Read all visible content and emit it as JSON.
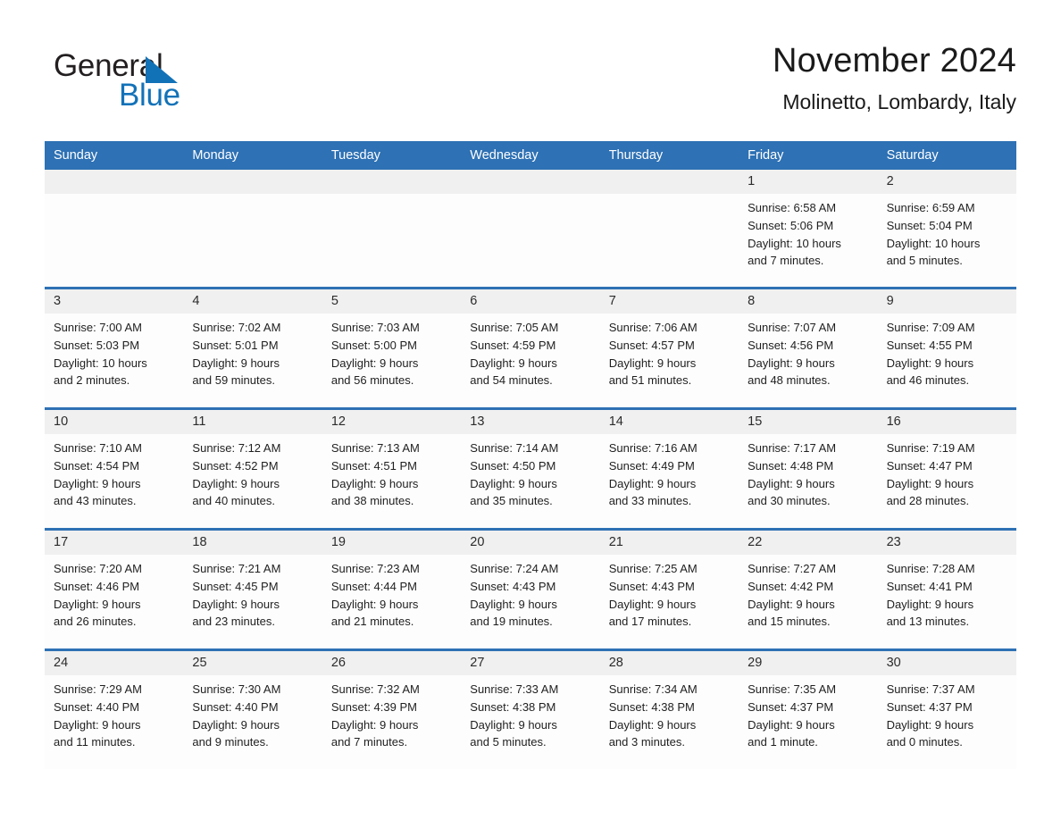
{
  "brand": {
    "name_part1": "General",
    "name_part2": "Blue",
    "triangle_icon": "triangle-icon",
    "color_black": "#231f20",
    "color_blue": "#1272b8"
  },
  "header": {
    "title": "November 2024",
    "subtitle": "Molinetto, Lombardy, Italy"
  },
  "theme": {
    "header_blue": "#2e71b4",
    "daynum_band": "#f0f0f0",
    "cell_bg": "#fdfdfd",
    "text": "#1f1f1f"
  },
  "weekdays": [
    "Sunday",
    "Monday",
    "Tuesday",
    "Wednesday",
    "Thursday",
    "Friday",
    "Saturday"
  ],
  "weeks": [
    [
      {
        "day": "",
        "sunrise": "",
        "sunset": "",
        "daylight1": "",
        "daylight2": ""
      },
      {
        "day": "",
        "sunrise": "",
        "sunset": "",
        "daylight1": "",
        "daylight2": ""
      },
      {
        "day": "",
        "sunrise": "",
        "sunset": "",
        "daylight1": "",
        "daylight2": ""
      },
      {
        "day": "",
        "sunrise": "",
        "sunset": "",
        "daylight1": "",
        "daylight2": ""
      },
      {
        "day": "",
        "sunrise": "",
        "sunset": "",
        "daylight1": "",
        "daylight2": ""
      },
      {
        "day": "1",
        "sunrise": "Sunrise: 6:58 AM",
        "sunset": "Sunset: 5:06 PM",
        "daylight1": "Daylight: 10 hours",
        "daylight2": "and 7 minutes."
      },
      {
        "day": "2",
        "sunrise": "Sunrise: 6:59 AM",
        "sunset": "Sunset: 5:04 PM",
        "daylight1": "Daylight: 10 hours",
        "daylight2": "and 5 minutes."
      }
    ],
    [
      {
        "day": "3",
        "sunrise": "Sunrise: 7:00 AM",
        "sunset": "Sunset: 5:03 PM",
        "daylight1": "Daylight: 10 hours",
        "daylight2": "and 2 minutes."
      },
      {
        "day": "4",
        "sunrise": "Sunrise: 7:02 AM",
        "sunset": "Sunset: 5:01 PM",
        "daylight1": "Daylight: 9 hours",
        "daylight2": "and 59 minutes."
      },
      {
        "day": "5",
        "sunrise": "Sunrise: 7:03 AM",
        "sunset": "Sunset: 5:00 PM",
        "daylight1": "Daylight: 9 hours",
        "daylight2": "and 56 minutes."
      },
      {
        "day": "6",
        "sunrise": "Sunrise: 7:05 AM",
        "sunset": "Sunset: 4:59 PM",
        "daylight1": "Daylight: 9 hours",
        "daylight2": "and 54 minutes."
      },
      {
        "day": "7",
        "sunrise": "Sunrise: 7:06 AM",
        "sunset": "Sunset: 4:57 PM",
        "daylight1": "Daylight: 9 hours",
        "daylight2": "and 51 minutes."
      },
      {
        "day": "8",
        "sunrise": "Sunrise: 7:07 AM",
        "sunset": "Sunset: 4:56 PM",
        "daylight1": "Daylight: 9 hours",
        "daylight2": "and 48 minutes."
      },
      {
        "day": "9",
        "sunrise": "Sunrise: 7:09 AM",
        "sunset": "Sunset: 4:55 PM",
        "daylight1": "Daylight: 9 hours",
        "daylight2": "and 46 minutes."
      }
    ],
    [
      {
        "day": "10",
        "sunrise": "Sunrise: 7:10 AM",
        "sunset": "Sunset: 4:54 PM",
        "daylight1": "Daylight: 9 hours",
        "daylight2": "and 43 minutes."
      },
      {
        "day": "11",
        "sunrise": "Sunrise: 7:12 AM",
        "sunset": "Sunset: 4:52 PM",
        "daylight1": "Daylight: 9 hours",
        "daylight2": "and 40 minutes."
      },
      {
        "day": "12",
        "sunrise": "Sunrise: 7:13 AM",
        "sunset": "Sunset: 4:51 PM",
        "daylight1": "Daylight: 9 hours",
        "daylight2": "and 38 minutes."
      },
      {
        "day": "13",
        "sunrise": "Sunrise: 7:14 AM",
        "sunset": "Sunset: 4:50 PM",
        "daylight1": "Daylight: 9 hours",
        "daylight2": "and 35 minutes."
      },
      {
        "day": "14",
        "sunrise": "Sunrise: 7:16 AM",
        "sunset": "Sunset: 4:49 PM",
        "daylight1": "Daylight: 9 hours",
        "daylight2": "and 33 minutes."
      },
      {
        "day": "15",
        "sunrise": "Sunrise: 7:17 AM",
        "sunset": "Sunset: 4:48 PM",
        "daylight1": "Daylight: 9 hours",
        "daylight2": "and 30 minutes."
      },
      {
        "day": "16",
        "sunrise": "Sunrise: 7:19 AM",
        "sunset": "Sunset: 4:47 PM",
        "daylight1": "Daylight: 9 hours",
        "daylight2": "and 28 minutes."
      }
    ],
    [
      {
        "day": "17",
        "sunrise": "Sunrise: 7:20 AM",
        "sunset": "Sunset: 4:46 PM",
        "daylight1": "Daylight: 9 hours",
        "daylight2": "and 26 minutes."
      },
      {
        "day": "18",
        "sunrise": "Sunrise: 7:21 AM",
        "sunset": "Sunset: 4:45 PM",
        "daylight1": "Daylight: 9 hours",
        "daylight2": "and 23 minutes."
      },
      {
        "day": "19",
        "sunrise": "Sunrise: 7:23 AM",
        "sunset": "Sunset: 4:44 PM",
        "daylight1": "Daylight: 9 hours",
        "daylight2": "and 21 minutes."
      },
      {
        "day": "20",
        "sunrise": "Sunrise: 7:24 AM",
        "sunset": "Sunset: 4:43 PM",
        "daylight1": "Daylight: 9 hours",
        "daylight2": "and 19 minutes."
      },
      {
        "day": "21",
        "sunrise": "Sunrise: 7:25 AM",
        "sunset": "Sunset: 4:43 PM",
        "daylight1": "Daylight: 9 hours",
        "daylight2": "and 17 minutes."
      },
      {
        "day": "22",
        "sunrise": "Sunrise: 7:27 AM",
        "sunset": "Sunset: 4:42 PM",
        "daylight1": "Daylight: 9 hours",
        "daylight2": "and 15 minutes."
      },
      {
        "day": "23",
        "sunrise": "Sunrise: 7:28 AM",
        "sunset": "Sunset: 4:41 PM",
        "daylight1": "Daylight: 9 hours",
        "daylight2": "and 13 minutes."
      }
    ],
    [
      {
        "day": "24",
        "sunrise": "Sunrise: 7:29 AM",
        "sunset": "Sunset: 4:40 PM",
        "daylight1": "Daylight: 9 hours",
        "daylight2": "and 11 minutes."
      },
      {
        "day": "25",
        "sunrise": "Sunrise: 7:30 AM",
        "sunset": "Sunset: 4:40 PM",
        "daylight1": "Daylight: 9 hours",
        "daylight2": "and 9 minutes."
      },
      {
        "day": "26",
        "sunrise": "Sunrise: 7:32 AM",
        "sunset": "Sunset: 4:39 PM",
        "daylight1": "Daylight: 9 hours",
        "daylight2": "and 7 minutes."
      },
      {
        "day": "27",
        "sunrise": "Sunrise: 7:33 AM",
        "sunset": "Sunset: 4:38 PM",
        "daylight1": "Daylight: 9 hours",
        "daylight2": "and 5 minutes."
      },
      {
        "day": "28",
        "sunrise": "Sunrise: 7:34 AM",
        "sunset": "Sunset: 4:38 PM",
        "daylight1": "Daylight: 9 hours",
        "daylight2": "and 3 minutes."
      },
      {
        "day": "29",
        "sunrise": "Sunrise: 7:35 AM",
        "sunset": "Sunset: 4:37 PM",
        "daylight1": "Daylight: 9 hours",
        "daylight2": "and 1 minute."
      },
      {
        "day": "30",
        "sunrise": "Sunrise: 7:37 AM",
        "sunset": "Sunset: 4:37 PM",
        "daylight1": "Daylight: 9 hours",
        "daylight2": "and 0 minutes."
      }
    ]
  ]
}
